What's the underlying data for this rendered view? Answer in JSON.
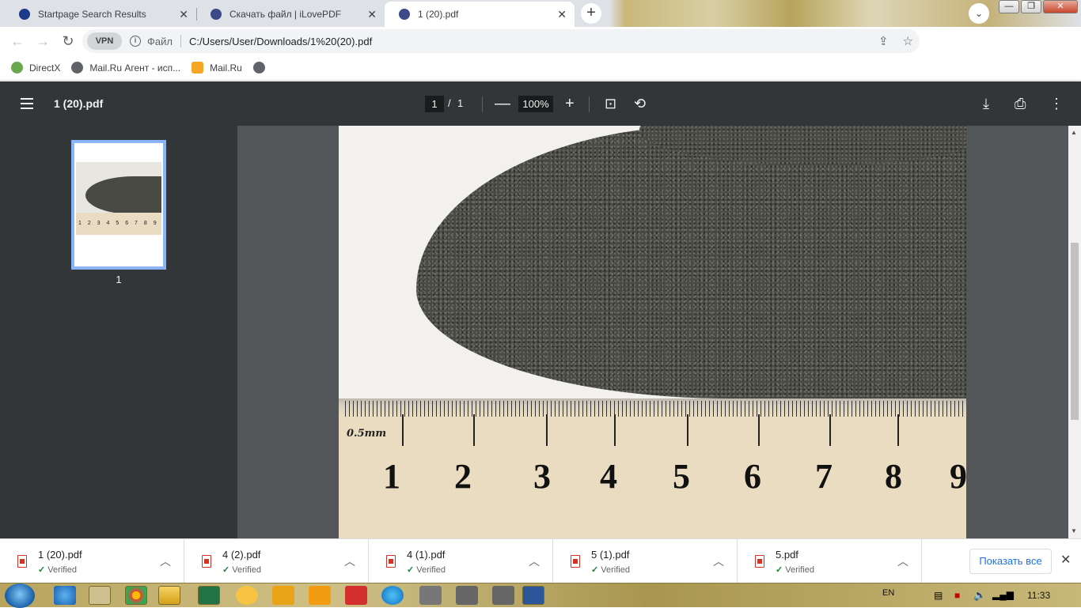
{
  "browser": {
    "tabs": [
      {
        "title": "Startpage Search Results",
        "close": "✕",
        "active": false
      },
      {
        "title": "Скачать файл | iLovePDF",
        "close": "✕",
        "active": false
      },
      {
        "title": "1 (20).pdf",
        "close": "✕",
        "active": true
      }
    ],
    "new_tab": "+",
    "tab_search": "⌄",
    "window_buttons": {
      "minimize": "—",
      "maximize": "❐",
      "close": "✕"
    },
    "nav": {
      "back": "←",
      "forward": "→",
      "reload": "↻"
    },
    "omnibox": {
      "vpn": "VPN",
      "info": "i",
      "protocol": "Файл",
      "url": "C:/Users/User/Downloads/1%20(20).pdf"
    },
    "bookmarks": [
      {
        "label": "DirectX",
        "icon": "leaf-icon",
        "color": "#6aa84f"
      },
      {
        "label": "Mail.Ru Агент - исп...",
        "icon": "globe-icon",
        "color": "#5f6368"
      },
      {
        "label": "Mail.Ru",
        "icon": "mailru-icon",
        "color": "#f5a623"
      },
      {
        "label": "",
        "icon": "globe-icon",
        "color": "#5f6368"
      }
    ]
  },
  "pdf_viewer": {
    "title": "1 (20).pdf",
    "current_page": "1",
    "page_separator": "/",
    "total_pages": "1",
    "zoom": "100%",
    "zoom_out": "—",
    "zoom_in": "+",
    "thumbnail_label": "1",
    "ruler_unit": "0.5mm",
    "ruler_numbers": [
      "1",
      "2",
      "3",
      "4",
      "5",
      "6",
      "7",
      "8",
      "9"
    ],
    "thumb_ruler": "1 2 3 4 5 6 7 8 9"
  },
  "downloads": {
    "items": [
      {
        "name": "1 (20).pdf",
        "status": "Verified"
      },
      {
        "name": "4 (2).pdf",
        "status": "Verified"
      },
      {
        "name": "4 (1).pdf",
        "status": "Verified"
      },
      {
        "name": "5 (1).pdf",
        "status": "Verified"
      },
      {
        "name": "5.pdf",
        "status": "Verified"
      }
    ],
    "show_all": "Показать все",
    "close": "✕"
  },
  "taskbar": {
    "language": "EN",
    "clock": "11:33"
  },
  "colors": {
    "pdf_toolbar": "#323639",
    "pdf_background": "#525659",
    "accent": "#1a73e8",
    "thumb_border": "#8ab4f8"
  }
}
